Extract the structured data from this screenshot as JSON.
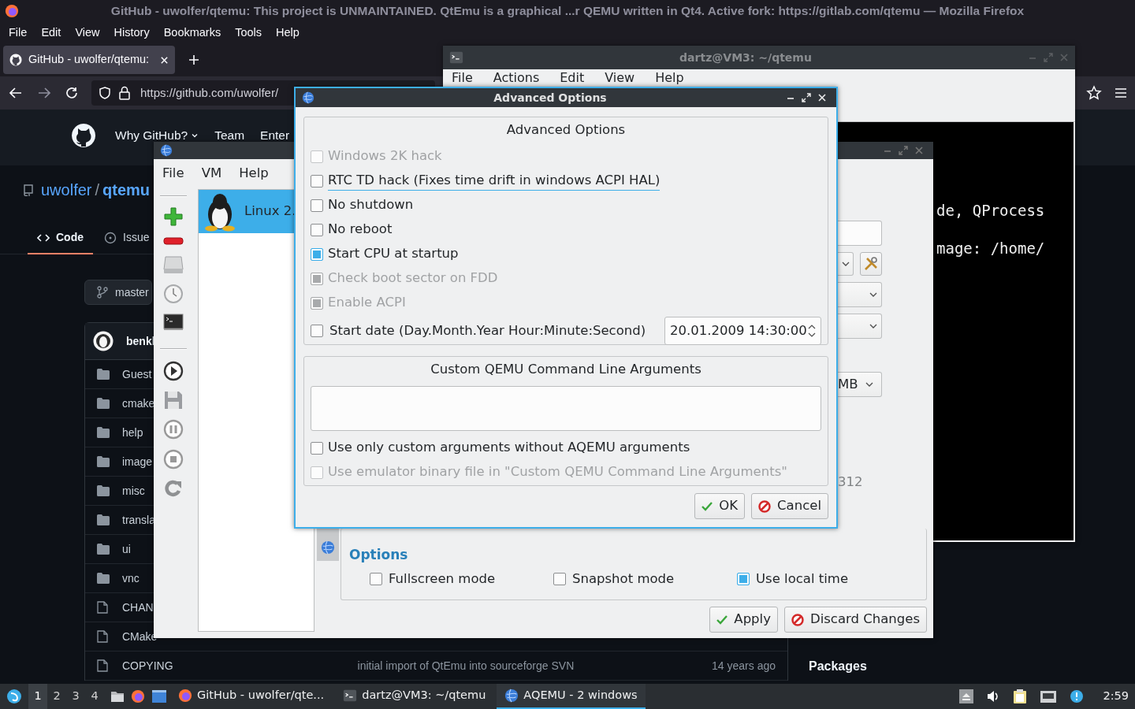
{
  "firefox": {
    "title": "GitHub - uwolfer/qtemu: This project is UNMAINTAINED. QtEmu is a graphical ...r QEMU written in Qt4. Active fork: https://gitlab.com/qtemu — Mozilla Firefox",
    "menu": [
      "File",
      "Edit",
      "View",
      "History",
      "Bookmarks",
      "Tools",
      "Help"
    ],
    "tab": {
      "label": "GitHub - uwolfer/qtemu:"
    },
    "url": "https://github.com/uwolfer/",
    "github": {
      "nav": [
        "Why GitHub?",
        "Team",
        "Enter"
      ],
      "owner": "uwolfer",
      "separator": "/",
      "repo": "qtemu",
      "repo_tabs": [
        {
          "label": "Code",
          "selected": true
        },
        {
          "label": "Issue",
          "selected": false
        }
      ],
      "branch": "master",
      "author": "benkl",
      "files": [
        {
          "kind": "folder",
          "name": "Guest"
        },
        {
          "kind": "folder",
          "name": "cmake"
        },
        {
          "kind": "folder",
          "name": "help"
        },
        {
          "kind": "folder",
          "name": "image"
        },
        {
          "kind": "folder",
          "name": "misc"
        },
        {
          "kind": "folder",
          "name": "transla"
        },
        {
          "kind": "folder",
          "name": "ui"
        },
        {
          "kind": "folder",
          "name": "vnc"
        },
        {
          "kind": "file",
          "name": "CHAN"
        },
        {
          "kind": "file",
          "name": "CMake"
        },
        {
          "kind": "file",
          "name": "COPYING",
          "message": "initial import of QtEmu into sourceforge SVN",
          "age": "14 years ago"
        }
      ],
      "sidebar_heading": "Packages"
    }
  },
  "terminal": {
    "title": "dartz@VM3: ~/qtemu",
    "menu": [
      "File",
      "Actions",
      "Edit",
      "View",
      "Help"
    ],
    "lines": [
      "de, QProcess",
      "mage: /home/"
    ]
  },
  "aqemu": {
    "menu": [
      "File",
      "VM",
      "Help"
    ],
    "vms": [
      {
        "name": "Linux 2.",
        "selected": true
      }
    ],
    "memory_unit": "MB",
    "value_fragment": "312",
    "options_title": "Options",
    "options": [
      {
        "label": "Fullscreen mode",
        "checked": false
      },
      {
        "label": "Snapshot mode",
        "checked": false
      },
      {
        "label": "Use local time",
        "checked": true
      }
    ],
    "buttons": [
      {
        "label": "Apply",
        "kind": "ok"
      },
      {
        "label": "Discard Changes",
        "kind": "cancel"
      }
    ]
  },
  "dialog": {
    "title": "Advanced Options",
    "group_title": "Advanced Options",
    "options": [
      {
        "label": "Windows 2K hack",
        "checked": false,
        "disabled": true,
        "focused": false
      },
      {
        "label": "RTC TD hack (Fixes time drift in windows ACPI HAL)",
        "checked": false,
        "disabled": false,
        "focused": true
      },
      {
        "label": "No shutdown",
        "checked": false,
        "disabled": false,
        "focused": false
      },
      {
        "label": "No reboot",
        "checked": false,
        "disabled": false,
        "focused": false
      },
      {
        "label": "Start CPU at startup",
        "checked": true,
        "disabled": false,
        "focused": false
      },
      {
        "label": "Check boot sector on FDD",
        "checked": true,
        "disabled": true,
        "focused": false
      },
      {
        "label": "Enable ACPI",
        "checked": true,
        "disabled": true,
        "focused": false
      }
    ],
    "start_date": {
      "label": "Start date (Day.Month.Year Hour:Minute:Second)",
      "checked": false,
      "value": "20.01.2009 14:30:00"
    },
    "custom_title": "Custom QEMU Command Line Arguments",
    "custom_options": [
      {
        "label": "Use only custom arguments without AQEMU arguments",
        "checked": false,
        "disabled": false
      },
      {
        "label": "Use emulator binary file in \"Custom QEMU Command Line Arguments\"",
        "checked": false,
        "disabled": true
      }
    ],
    "buttons": [
      {
        "label": "OK",
        "kind": "ok"
      },
      {
        "label": "Cancel",
        "kind": "cancel"
      }
    ]
  },
  "taskbar": {
    "workspaces": [
      {
        "label": "1",
        "selected": true
      },
      {
        "label": "2",
        "selected": false
      },
      {
        "label": "3",
        "selected": false
      },
      {
        "label": "4",
        "selected": false
      }
    ],
    "tasks": [
      {
        "label": "GitHub - uwolfer/qte...",
        "kind": "browser",
        "selected": false
      },
      {
        "label": "dartz@VM3: ~/qtemu",
        "kind": "terminal",
        "selected": false
      },
      {
        "label": "AQEMU - 2 windows",
        "kind": "aqemu",
        "selected": true
      }
    ],
    "clock": "2:59"
  }
}
